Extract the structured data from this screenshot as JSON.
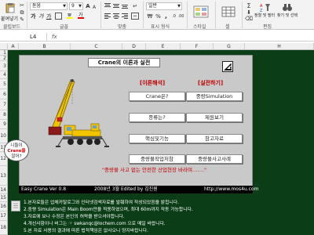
{
  "ribbon": {
    "paste_label": "붙여넣기",
    "clipboard_label": "클립보드",
    "font_name": "돋움",
    "font_size": "9",
    "font_group_label": "글꼴",
    "bold": "가",
    "italic": "가",
    "underline": "가",
    "align_group_label": "맞춤",
    "number_format": "일반",
    "number_group_label": "표시 형식",
    "percent": "%",
    "comma": ",",
    "style_label": "스타일",
    "cells_label": "셀",
    "sort_label": "정렬 및 필터",
    "find_label": "찾기 및 선택",
    "edit_group_label": "편집"
  },
  "formula_bar": {
    "cell_ref": "L4",
    "fx": "fx",
    "content": ""
  },
  "columns": [
    "A",
    "B",
    "C",
    "D",
    "E",
    "F",
    "G",
    "H"
  ],
  "rows": [
    "1",
    "2",
    "3",
    "4",
    "5",
    "6",
    "7",
    "8",
    "9",
    "10",
    "11",
    "12",
    "13",
    "14",
    "15",
    "16",
    "17",
    "18"
  ],
  "panel": {
    "title": "Crane의 이론과 실전",
    "section_left": "[이론해석]",
    "section_right": "[실전하기]",
    "buttons_left": [
      "Crane은?",
      "종류는?",
      "핵심및기능",
      "중량물작업처참"
    ],
    "buttons_right": [
      "중량Simulation",
      "제원보기",
      "참고자료",
      "중량물사고사례"
    ],
    "bubble_line1": "니들이",
    "bubble_line2": "Crane을",
    "bubble_line3": "알어?",
    "motto": "\"중량물 사고 없는 안전한 산업현장 바라며…….\"",
    "footer_left": "Easy Crane  Ver 0.8",
    "footer_mid": "2008년  3월   Edited by 김진원",
    "footer_right": "http://www.mos4u.com"
  },
  "notes": [
    "1.본자료들은 업체카탈로그와 인터넷검색자료를 발췌하여 작성되었음을 밝힙니다.",
    "2.중량 Simulation은 Main Boom만을 적용하였으며, 최대 60m까지 작동 가능합니다.",
    "3.자료에 보나 수정은 본인의 허락을 받으셔야합니다.",
    "4.개선사항이나 버그는 ☞ swkanqc@lochem.com 으로 메일 바랍니다.",
    "5.본 자료 사용의 결과에 따른 법적책임은 없사오니 양지바랍니다."
  ],
  "colors": {
    "sheet_bg": "#0b3d16",
    "panel_bg": "#c9c9c9",
    "accent_red": "#c00000"
  }
}
